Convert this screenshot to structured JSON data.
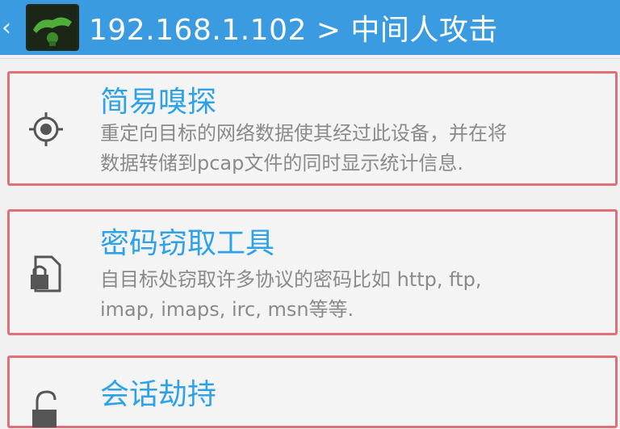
{
  "header": {
    "back_glyph": "‹",
    "title": "192.168.1.102 > 中间人攻击",
    "bar_color": "#3a9be0"
  },
  "items": [
    {
      "title": "简易嗅探",
      "desc_line1": "重定向目标的网络数据使其经过此设备，并在将",
      "desc_line2": "数据转储到pcap文件的同时显示统计信息.",
      "icon": "crosshair-icon"
    },
    {
      "title": "密码窃取工具",
      "desc_line1": "自目标处窃取许多协议的密码比如 http, ftp,",
      "desc_line2": "imap, imaps, irc, msn等等.",
      "icon": "locked-file-icon"
    },
    {
      "title": "会话劫持",
      "icon": "unlock-icon"
    }
  ],
  "colors": {
    "accent": "#2ea2e8",
    "highlight_border": "#e07078"
  }
}
